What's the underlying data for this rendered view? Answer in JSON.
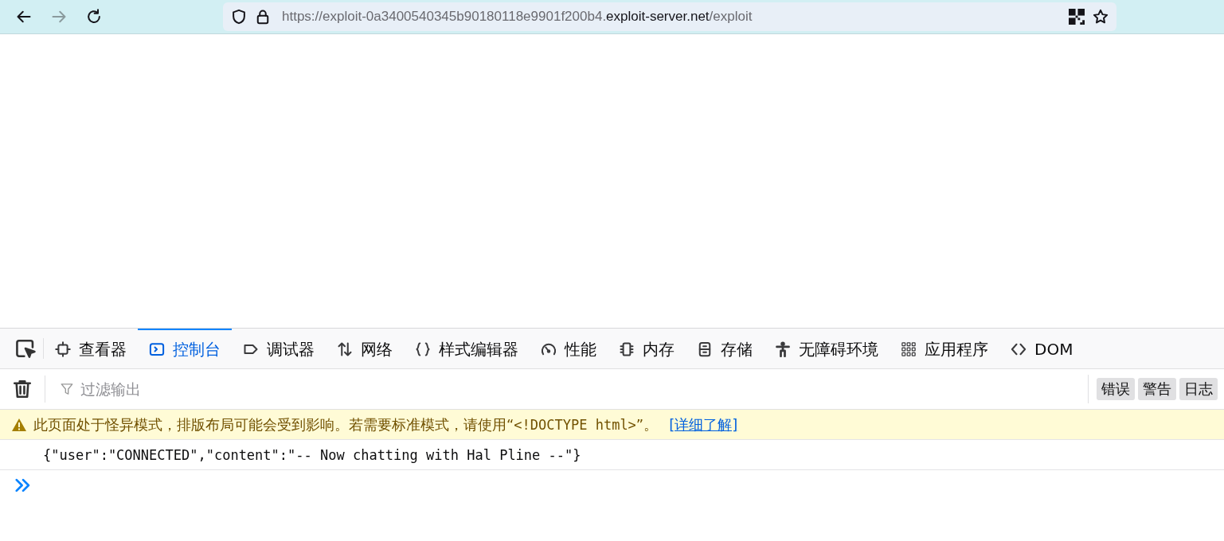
{
  "browser": {
    "url": [
      {
        "text": "https://exploit-0a3400540345b90180118e9901f200b4.",
        "emphasis": false
      },
      {
        "text": "exploit-server.net",
        "emphasis": true
      },
      {
        "text": "/exploit",
        "emphasis": false
      }
    ]
  },
  "devtools": {
    "tabs": [
      {
        "label": "查看器",
        "selected": false
      },
      {
        "label": "控制台",
        "selected": true
      },
      {
        "label": "调试器",
        "selected": false
      },
      {
        "label": "网络",
        "selected": false
      },
      {
        "label": "样式编辑器",
        "selected": false
      },
      {
        "label": "性能",
        "selected": false
      },
      {
        "label": "内存",
        "selected": false
      },
      {
        "label": "存储",
        "selected": false
      },
      {
        "label": "无障碍环境",
        "selected": false
      },
      {
        "label": "应用程序",
        "selected": false
      },
      {
        "label": "DOM",
        "selected": false
      }
    ],
    "filter": {
      "placeholder": "过滤输出"
    },
    "levels": [
      "错误",
      "警告",
      "日志"
    ],
    "messages": [
      {
        "kind": "warning",
        "parts": [
          {
            "kind": "text",
            "text": "此页面处于怪异模式，排版布局可能会受到影响。若需要标准模式，请使用“"
          },
          {
            "kind": "code",
            "text": "<!DOCTYPE html>"
          },
          {
            "kind": "text",
            "text": "”。"
          }
        ],
        "link": "[详细了解]"
      },
      {
        "kind": "log",
        "parts": [
          {
            "kind": "code",
            "text": "{\"user\":\"CONNECTED\",\"content\":\"-- Now chatting with Hal Pline --\"}"
          }
        ]
      }
    ]
  }
}
